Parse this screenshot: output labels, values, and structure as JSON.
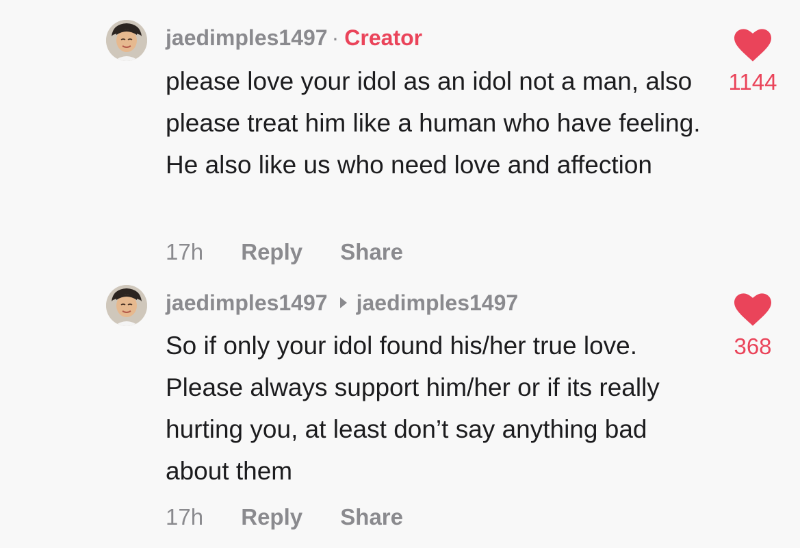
{
  "colors": {
    "background": "#f8f8f8",
    "accent": "#ea445a",
    "muted": "#8a8a8e",
    "text": "#1c1c1e"
  },
  "comments": [
    {
      "username": "jaedimples1497",
      "separator": "·",
      "creator_badge": "Creator",
      "reply_to": "",
      "text": "please love your idol as an idol not a man, also please treat him like a human who have feeling. He also like us who need love and affection",
      "time": "17h",
      "reply_label": "Reply",
      "share_label": "Share",
      "like_icon": "heart-icon",
      "like_count": "1144"
    },
    {
      "username": "jaedimples1497",
      "separator": "",
      "creator_badge": "",
      "reply_to": "jaedimples1497",
      "text": "So if only your idol found his/her true love. Please always support him/her or if its really hurting you, at least don’t say anything bad about them",
      "time": "17h",
      "reply_label": "Reply",
      "share_label": "Share",
      "like_icon": "heart-icon",
      "like_count": "368"
    }
  ]
}
